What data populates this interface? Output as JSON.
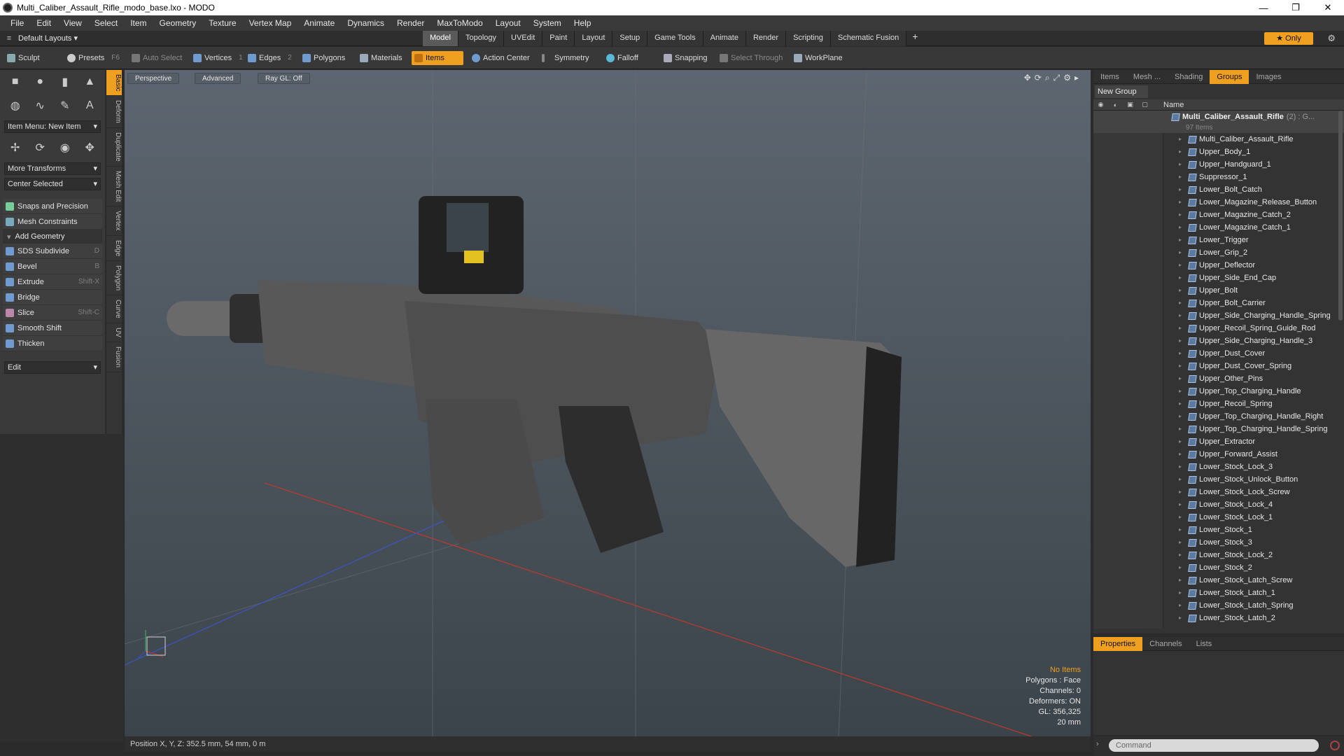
{
  "window": {
    "title": "Multi_Caliber_Assault_Rifle_modo_base.lxo - MODO",
    "min": "—",
    "max": "❐",
    "close": "✕"
  },
  "menu": [
    "File",
    "Edit",
    "View",
    "Select",
    "Item",
    "Geometry",
    "Texture",
    "Vertex Map",
    "Animate",
    "Dynamics",
    "Render",
    "MaxToModo",
    "Layout",
    "System",
    "Help"
  ],
  "layoutbar": {
    "layout": "Default Layouts ▾",
    "tabs": [
      {
        "label": "Model",
        "active": true
      },
      {
        "label": "Topology"
      },
      {
        "label": "UVEdit"
      },
      {
        "label": "Paint"
      },
      {
        "label": "Layout"
      },
      {
        "label": "Setup"
      },
      {
        "label": "Game Tools"
      },
      {
        "label": "Animate"
      },
      {
        "label": "Render"
      },
      {
        "label": "Scripting"
      },
      {
        "label": "Schematic Fusion"
      }
    ],
    "plus": "+",
    "only": "★ Only"
  },
  "toolbar": {
    "sculpt": "Sculpt",
    "presets": "Presets",
    "presets_key": "F6",
    "auto_select": "Auto Select",
    "vertices": "Vertices",
    "vertices_key": "1",
    "edges": "Edges",
    "edges_key": "2",
    "polygons": "Polygons",
    "materials": "Materials",
    "items": "Items",
    "action_center": "Action Center",
    "symmetry": "Symmetry",
    "falloff": "Falloff",
    "snapping": "Snapping",
    "select_through": "Select Through",
    "workplane": "WorkPlane"
  },
  "leftpanel": {
    "item_menu": "Item Menu: New Item",
    "more_transforms": "More Transforms",
    "center_selected": "Center Selected",
    "snaps": "Snaps and Precision",
    "mesh_constraints": "Mesh Constraints",
    "add_geometry": "Add Geometry",
    "tools": [
      {
        "label": "SDS Subdivide",
        "key": "D"
      },
      {
        "label": "Bevel",
        "key": "B"
      },
      {
        "label": "Extrude",
        "key": "Shift-X"
      },
      {
        "label": "Bridge",
        "key": ""
      },
      {
        "label": "Slice",
        "key": "Shift-C"
      },
      {
        "label": "Smooth Shift",
        "key": ""
      },
      {
        "label": "Thicken",
        "key": ""
      }
    ],
    "edit": "Edit",
    "vtabs": [
      "Basic",
      "Deform",
      "Duplicate",
      "Mesh Edit",
      "Vertex",
      "Edge",
      "Polygon",
      "Curve",
      "UV",
      "Fusion"
    ]
  },
  "viewport": {
    "tabs": [
      "Perspective",
      "Advanced",
      "Ray GL: Off"
    ],
    "info": {
      "no_items": "No Items",
      "polygons": "Polygons : Face",
      "channels": "Channels: 0",
      "deformers": "Deformers: ON",
      "gl": "GL: 356,325",
      "scale": "20 mm"
    },
    "status": "Position X, Y, Z:  352.5 mm, 54 mm, 0 m"
  },
  "rightpanel": {
    "tabs": [
      "Items",
      "Mesh ...",
      "Shading",
      "Groups",
      "Images"
    ],
    "active_tab": "Groups",
    "new_group": "New Group",
    "col_name": "Name",
    "group_name": "Multi_Caliber_Assault_Rifle",
    "group_count": "(2) : G...",
    "group_items": "97 Items",
    "items": [
      "Multi_Caliber_Assault_Rifle",
      "Upper_Body_1",
      "Upper_Handguard_1",
      "Suppressor_1",
      "Lower_Bolt_Catch",
      "Lower_Magazine_Release_Button",
      "Lower_Magazine_Catch_2",
      "Lower_Magazine_Catch_1",
      "Lower_Trigger",
      "Lower_Grip_2",
      "Upper_Deflector",
      "Upper_Side_End_Cap",
      "Upper_Bolt",
      "Upper_Bolt_Carrier",
      "Upper_Side_Charging_Handle_Spring",
      "Upper_Recoil_Spring_Guide_Rod",
      "Upper_Side_Charging_Handle_3",
      "Upper_Dust_Cover",
      "Upper_Dust_Cover_Spring",
      "Upper_Other_Pins",
      "Upper_Top_Charging_Handle",
      "Upper_Recoil_Spring",
      "Upper_Top_Charging_Handle_Right",
      "Upper_Top_Charging_Handle_Spring",
      "Upper_Extractor",
      "Upper_Forward_Assist",
      "Lower_Stock_Lock_3",
      "Lower_Stock_Unlock_Button",
      "Lower_Stock_Lock_Screw",
      "Lower_Stock_Lock_4",
      "Lower_Stock_Lock_1",
      "Lower_Stock_1",
      "Lower_Stock_3",
      "Lower_Stock_Lock_2",
      "Lower_Stock_2",
      "Lower_Stock_Latch_Screw",
      "Lower_Stock_Latch_1",
      "Lower_Stock_Latch_Spring",
      "Lower_Stock_Latch_2"
    ]
  },
  "proppanel": {
    "tabs": [
      "Properties",
      "Channels",
      "Lists"
    ]
  },
  "command": {
    "placeholder": "Command"
  }
}
